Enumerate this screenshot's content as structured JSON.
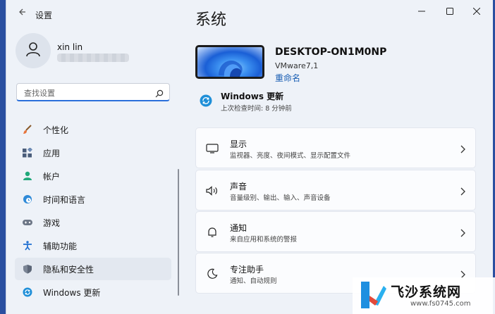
{
  "app": {
    "title": "设置",
    "back_icon": "back-arrow-icon"
  },
  "window_controls": {
    "minimize": "minimize-icon",
    "maximize": "maximize-icon",
    "close": "close-icon"
  },
  "account": {
    "name": "xin lin",
    "avatar_icon": "person-icon"
  },
  "search": {
    "placeholder": "查找设置",
    "icon": "search-icon"
  },
  "nav": {
    "items": [
      {
        "label": "个性化",
        "icon": "brush-icon",
        "active": false
      },
      {
        "label": "应用",
        "icon": "apps-icon",
        "active": false
      },
      {
        "label": "帐户",
        "icon": "account-icon",
        "active": false
      },
      {
        "label": "时间和语言",
        "icon": "globe-clock-icon",
        "active": false
      },
      {
        "label": "游戏",
        "icon": "gamepad-icon",
        "active": false
      },
      {
        "label": "辅助功能",
        "icon": "accessibility-icon",
        "active": false
      },
      {
        "label": "隐私和安全性",
        "icon": "shield-icon",
        "active": true
      },
      {
        "label": "Windows 更新",
        "icon": "update-icon",
        "active": false
      }
    ]
  },
  "main": {
    "title": "系统",
    "device": {
      "name": "DESKTOP-ON1M0NP",
      "model": "VMware7,1",
      "rename_label": "重命名"
    },
    "update": {
      "title": "Windows 更新",
      "subtitle": "上次检查时间: 8 分钟前"
    },
    "cards": [
      {
        "title": "显示",
        "subtitle": "监视器、亮度、夜间模式、显示配置文件",
        "icon": "monitor-icon"
      },
      {
        "title": "声音",
        "subtitle": "音量级别、输出、输入、声音设备",
        "icon": "speaker-icon"
      },
      {
        "title": "通知",
        "subtitle": "来自应用和系统的警报",
        "icon": "bell-icon"
      },
      {
        "title": "专注助手",
        "subtitle": "通知、自动规则",
        "icon": "moon-icon"
      }
    ]
  },
  "watermark": {
    "brand": "飞沙系统网",
    "url": "www.fs0745.com"
  },
  "colors": {
    "accent": "#2a6fdb",
    "link": "#1a5fb4",
    "background": "#eef2f8"
  }
}
